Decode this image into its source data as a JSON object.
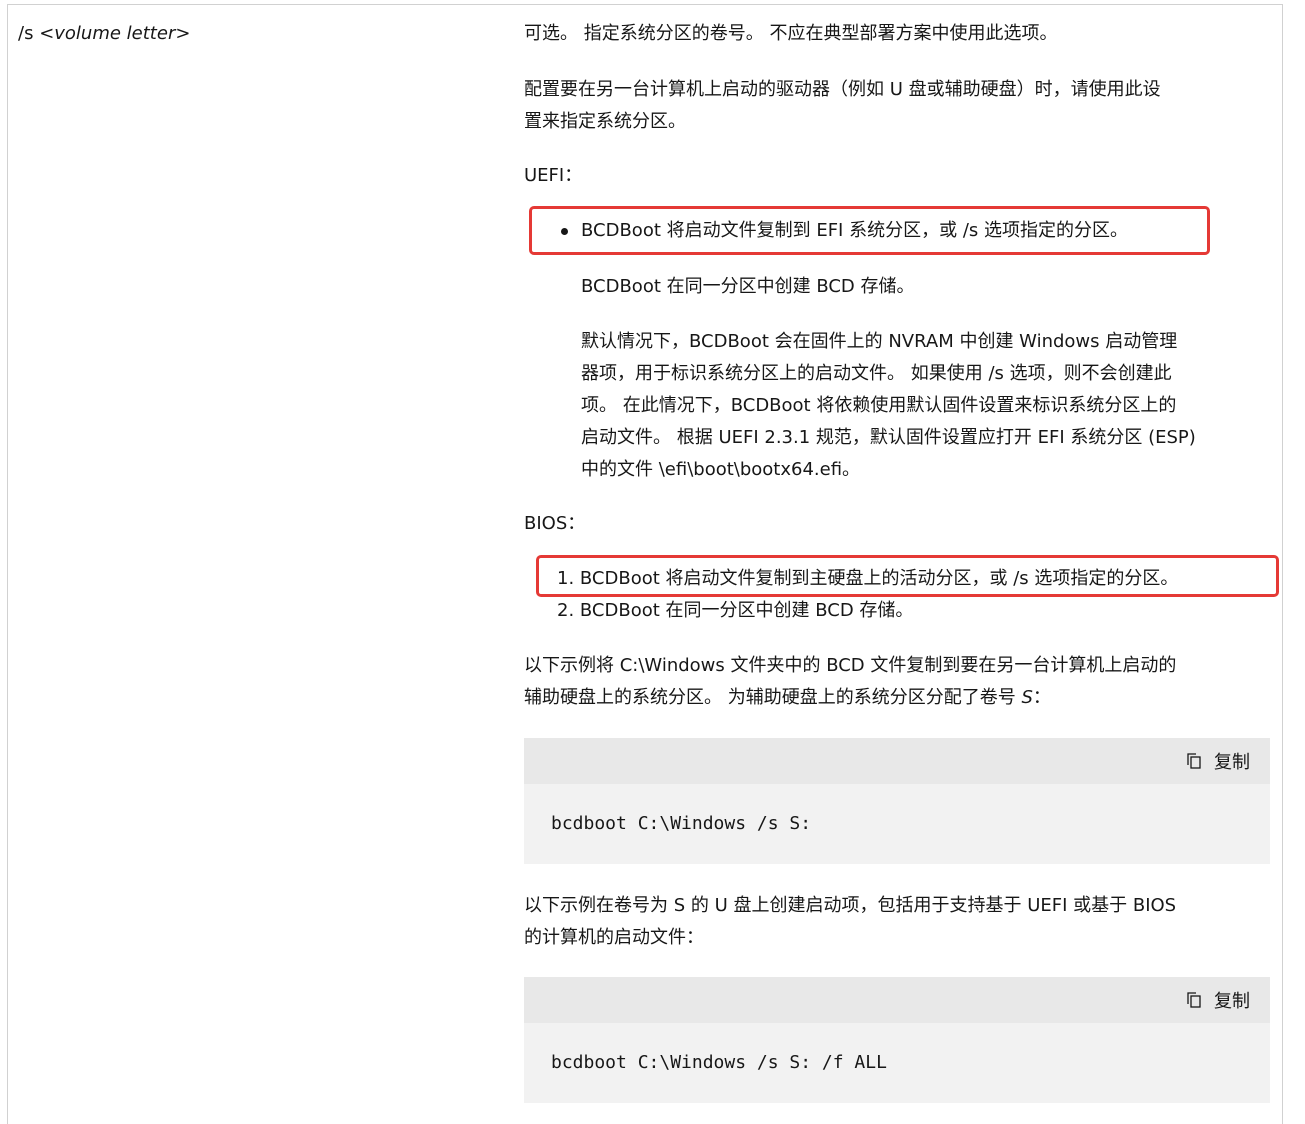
{
  "param": {
    "name": "/s",
    "arg": "<volume letter>"
  },
  "desc": {
    "p1": "可选。 指定系统分区的卷号。 不应在典型部署方案中使用此选项。",
    "p2_line1": "配置要在另一台计算机上启动的驱动器（例如 U 盘或辅助硬盘）时，请使用此设",
    "p2_line2": "置来指定系统分区。",
    "uefi_heading": "UEFI：",
    "uefi_bullet": "BCDBoot 将启动文件复制到 EFI 系统分区，或 /s 选项指定的分区。",
    "uefi_sub1": "BCDBoot 在同一分区中创建 BCD 存储。",
    "uefi_sub2_lines": [
      "默认情况下，BCDBoot 会在固件上的 NVRAM 中创建 Windows 启动管理",
      "器项，用于标识系统分区上的启动文件。 如果使用 /s 选项，则不会创建此",
      "项。 在此情况下，BCDBoot 将依赖使用默认固件设置来标识系统分区上的",
      "启动文件。 根据 UEFI 2.3.1 规范，默认固件设置应打开 EFI 系统分区 (ESP)",
      "中的文件 \\efi\\boot\\bootx64.efi。"
    ],
    "bios_heading": "BIOS：",
    "bios_items": [
      "1. BCDBoot 将启动文件复制到主硬盘上的活动分区，或 /s 选项指定的分区。",
      "2. BCDBoot 在同一分区中创建 BCD 存储。"
    ],
    "example1_line1": "以下示例将 C:\\Windows 文件夹中的 BCD 文件复制到要在另一台计算机上启动的",
    "example1_line2": "辅助硬盘上的系统分区。 为辅助硬盘上的系统分区分配了卷号 ",
    "example1_var": "S",
    "example1_end": "：",
    "code1": "bcdboot C:\\Windows /s S:",
    "example2_line1": "以下示例在卷号为 S 的 U 盘上创建启动项，包括用于支持基于 UEFI 或基于 BIOS",
    "example2_line2": "的计算机的启动文件：",
    "code2": "bcdboot C:\\Windows /s S: /f ALL",
    "copy_label": "复制"
  },
  "colors": {
    "highlight": "#e53935",
    "code_bg": "#f2f2f2",
    "code_header_bg": "#e8e8e8"
  }
}
